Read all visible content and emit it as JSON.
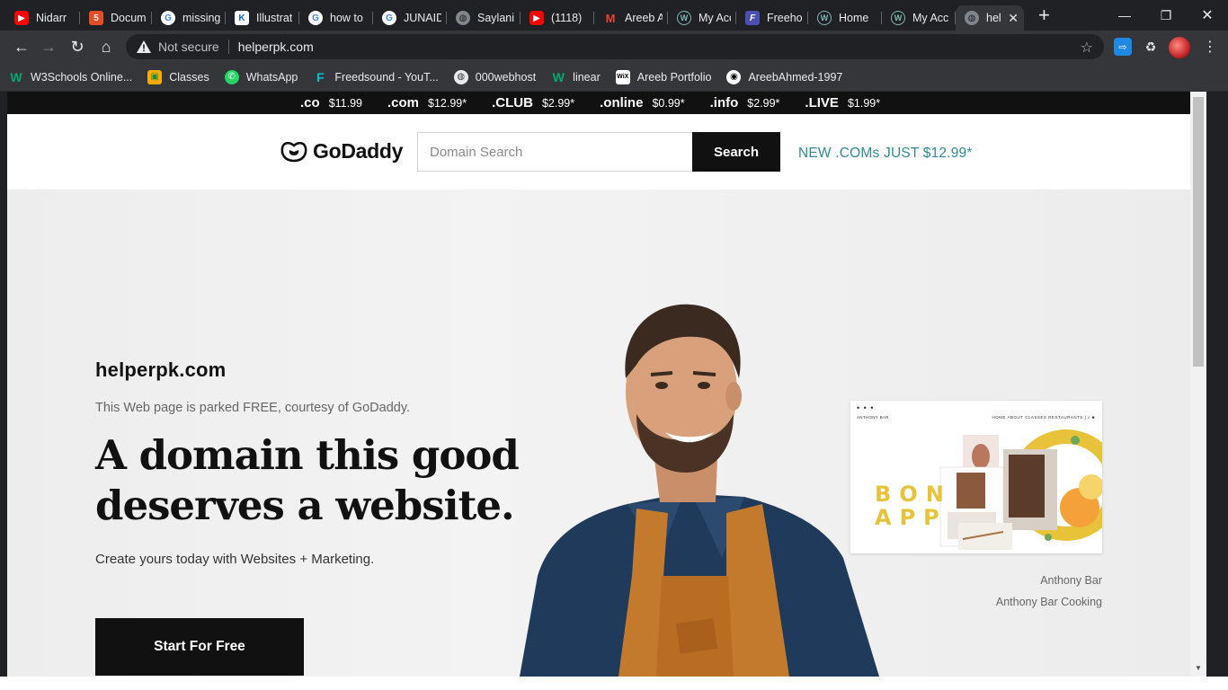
{
  "browser": {
    "tabs": [
      {
        "title": "Nidarr",
        "favicon": "youtube-icon"
      },
      {
        "title": "Docum",
        "favicon": "html-icon"
      },
      {
        "title": "missing",
        "favicon": "google-icon"
      },
      {
        "title": "Illustrat",
        "favicon": "k-icon"
      },
      {
        "title": "how to",
        "favicon": "google-icon"
      },
      {
        "title": "JUNAID",
        "favicon": "google-icon"
      },
      {
        "title": "Saylani",
        "favicon": "globe-icon"
      },
      {
        "title": "(1118) ‌",
        "favicon": "youtube-icon"
      },
      {
        "title": "Areeb A",
        "favicon": "gmail-icon"
      },
      {
        "title": "My Acc",
        "favicon": "wordpress-icon"
      },
      {
        "title": "Freehos",
        "favicon": "freehost-icon"
      },
      {
        "title": "Home",
        "favicon": "wordpress-icon"
      },
      {
        "title": "My Acc",
        "favicon": "wordpress-icon"
      },
      {
        "title": "help",
        "favicon": "globe-icon",
        "active": true
      }
    ],
    "security_label": "Not secure",
    "url": "helperpk.com"
  },
  "bookmarks": [
    {
      "label": "W3Schools Online...",
      "icon": "w3schools-icon"
    },
    {
      "label": "Classes",
      "icon": "classroom-icon"
    },
    {
      "label": "WhatsApp",
      "icon": "whatsapp-icon"
    },
    {
      "label": "Freedsound - YouT...",
      "icon": "freedsound-icon"
    },
    {
      "label": "000webhost",
      "icon": "globe-icon"
    },
    {
      "label": "linear",
      "icon": "w3schools-icon"
    },
    {
      "label": "Areeb Portfolio",
      "icon": "wix-icon"
    },
    {
      "label": "AreebAhmed-1997",
      "icon": "github-icon"
    }
  ],
  "promo_bar": [
    {
      "tld": ".co",
      "price": "$11.99"
    },
    {
      "tld": ".com",
      "price": "$12.99*"
    },
    {
      "tld": ".CLUB",
      "price": "$2.99*"
    },
    {
      "tld": ".online",
      "price": "$0.99*"
    },
    {
      "tld": ".info",
      "price": "$2.99*"
    },
    {
      "tld": ".LIVE",
      "price": "$1.99*"
    }
  ],
  "header": {
    "logo_text": "GoDaddy",
    "search_placeholder": "Domain Search",
    "search_button": "Search",
    "promo_text": "NEW .COMs JUST $12.99*"
  },
  "hero": {
    "domain": "helperpk.com",
    "parked_text": "This Web page is parked FREE, courtesy of GoDaddy.",
    "headline_line1": "A domain this good",
    "headline_line2": "deserves a website.",
    "subtext": "Create yours today with Websites + Marketing.",
    "cta": "Start For Free",
    "preview": {
      "dots": "• • •",
      "brand": "ANTHONY BAR",
      "nav": "HOME   ABOUT   CLASSES   RESTAURANTS   |  ⌕  ■",
      "art_line1": "BON",
      "art_line2": "APP",
      "caption1": "Anthony Bar",
      "caption2": "Anthony Bar Cooking"
    }
  },
  "colors": {
    "browser_bg": "#202124",
    "toolbar_bg": "#35363a",
    "promo_bar_bg": "#111111",
    "accent_teal": "#2f8a96",
    "cta_bg": "#111111",
    "card_yellow": "#e8c33a"
  }
}
